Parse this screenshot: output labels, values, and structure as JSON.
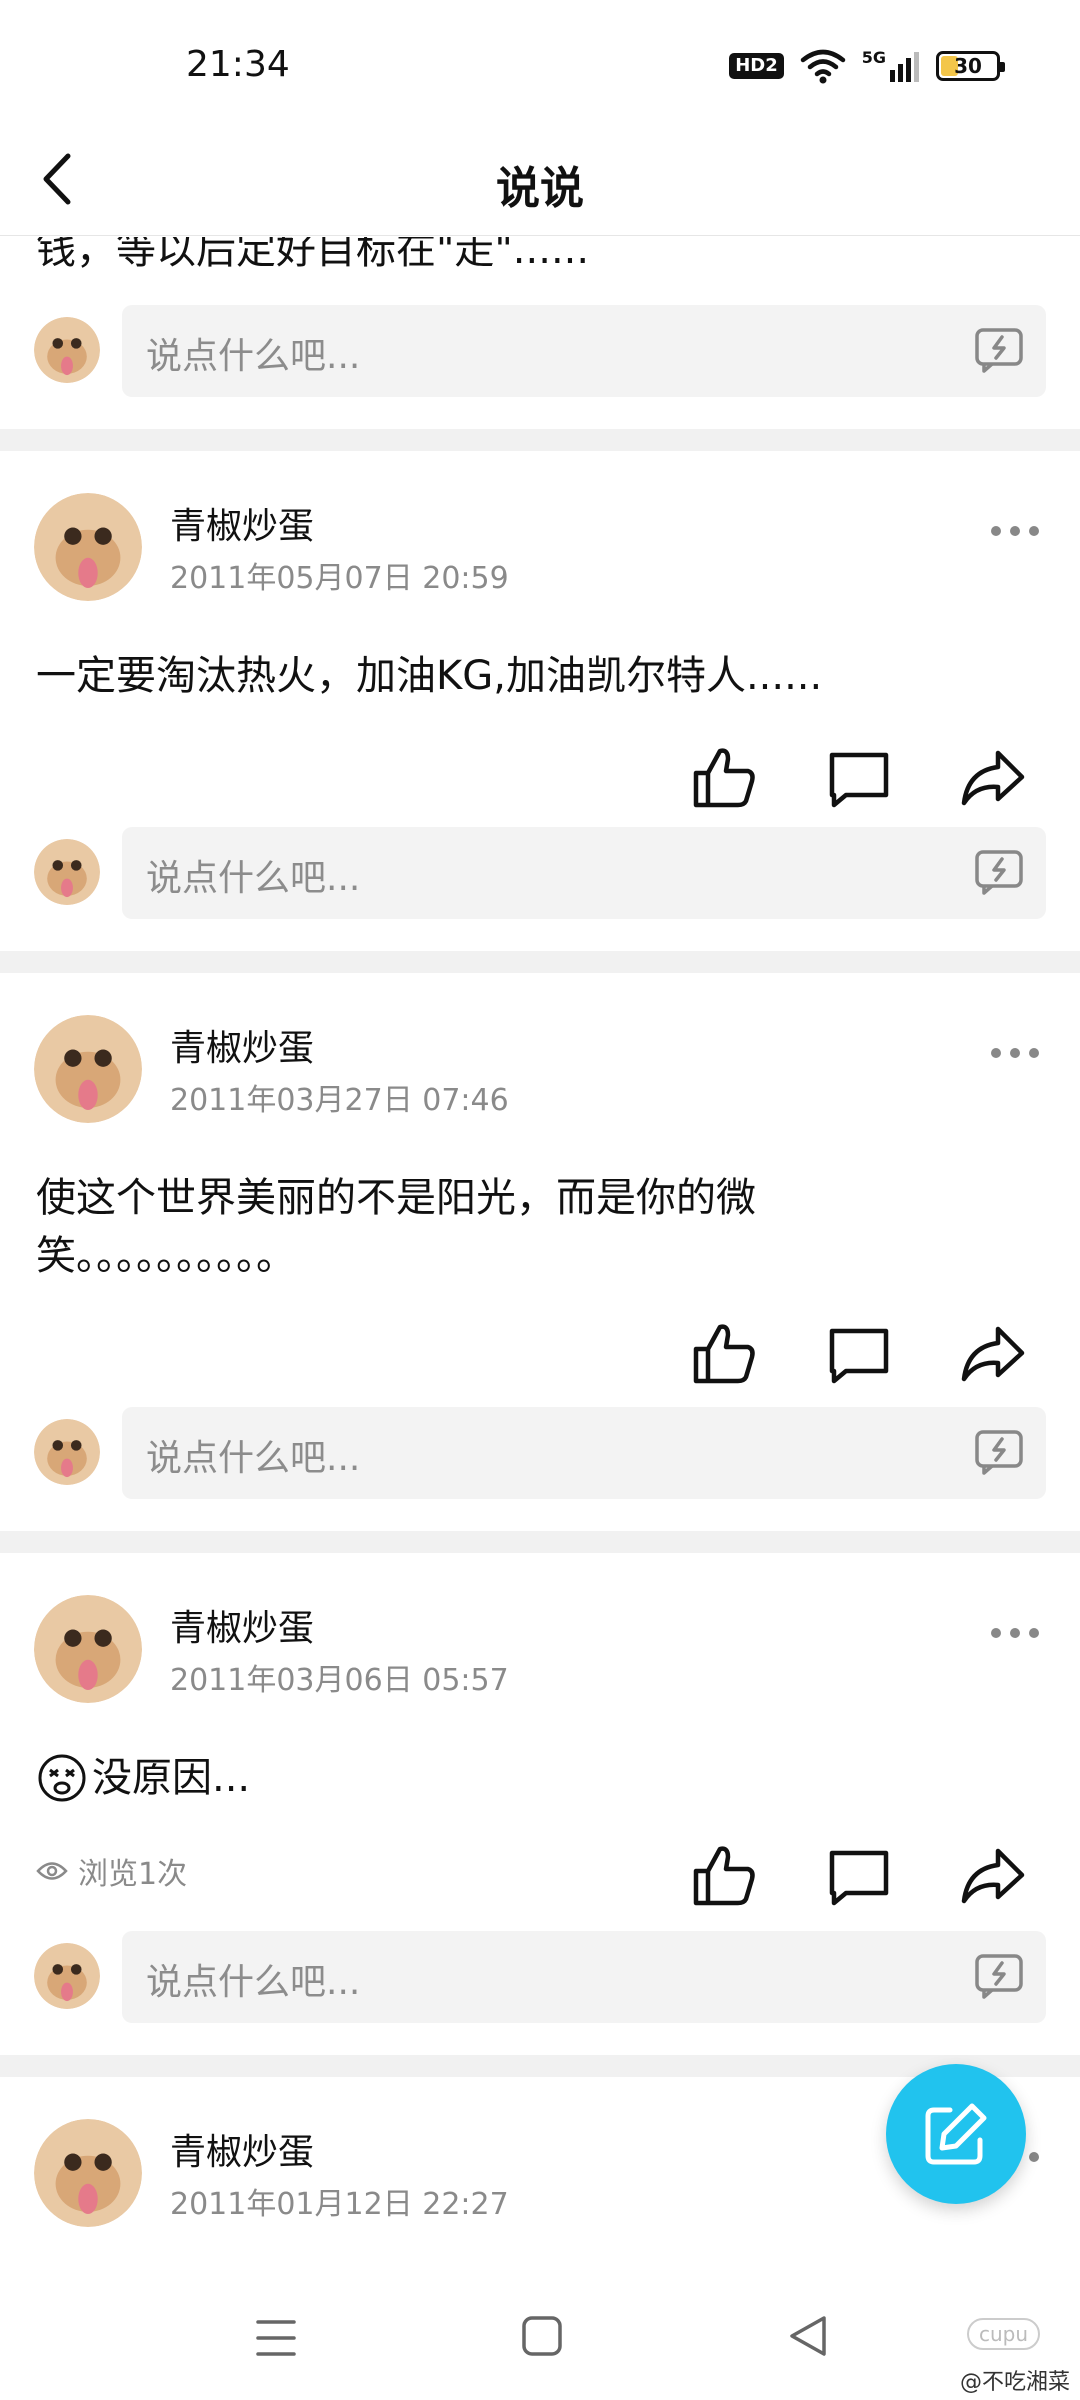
{
  "status_bar": {
    "time": "21:34",
    "hd_label": "HD2",
    "network_label": "5G",
    "battery_level": "30"
  },
  "header": {
    "title": "说说"
  },
  "partial_post": {
    "content": "钱，等以后定好目标在\"走\"......"
  },
  "comment_placeholder": "说点什么吧...",
  "posts": [
    {
      "user": "青椒炒蛋",
      "date": "2011年05月07日 20:59",
      "content": "一定要淘汰热火，加油KG,加油凯尔特人......"
    },
    {
      "user": "青椒炒蛋",
      "date": "2011年03月27日 07:46",
      "content": "使这个世界美丽的不是阳光，而是你的微笑。。。。。。。。。。"
    },
    {
      "user": "青椒炒蛋",
      "date": "2011年03月06日 05:57",
      "content": "没原因...",
      "views": "浏览1次"
    },
    {
      "user": "青椒炒蛋",
      "date": "2011年01月12日 22:27"
    }
  ],
  "watermark": {
    "text": "@不吃湘菜",
    "logo": "cupu"
  },
  "colors": {
    "accent": "#21c3ee",
    "input_bg": "#f3f3f3",
    "divider": "#f1f1f1",
    "meta_text": "#8a8a8a"
  }
}
